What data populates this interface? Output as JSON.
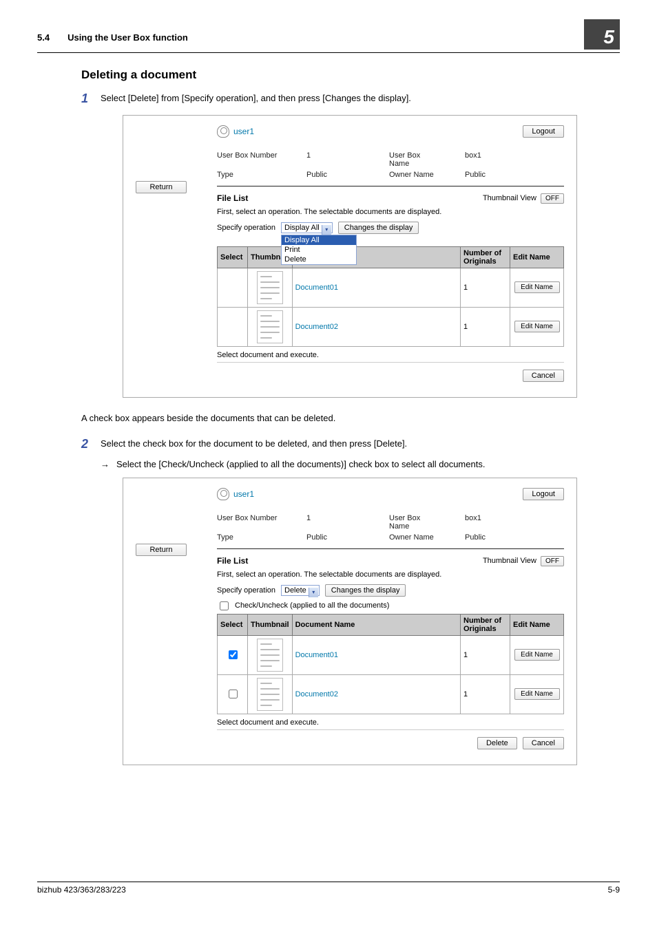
{
  "header": {
    "secnum": "5.4",
    "sectitle": "Using the User Box function",
    "chapnum": "5"
  },
  "subhead": "Deleting a document",
  "step1": {
    "num": "1",
    "text": "Select [Delete] from [Specify operation], and then press [Changes the display]."
  },
  "afterShot1": "A check box appears beside the documents that can be deleted.",
  "step2": {
    "num": "2",
    "text": "Select the check box for the document to be deleted, and then press [Delete].",
    "bullet": "Select the [Check/Uncheck (applied to all the documents)] check box to select all documents."
  },
  "app": {
    "username": "user1",
    "logout": "Logout",
    "return": "Return",
    "meta": {
      "boxnum_lbl": "User Box Number",
      "boxnum_val": "1",
      "boxname_lbl": "User Box\nName",
      "boxname_val": "box1",
      "type_lbl": "Type",
      "type_val": "Public",
      "owner_lbl": "Owner Name",
      "owner_val": "Public"
    },
    "filelist_lbl": "File List",
    "thumbview_lbl": "Thumbnail View",
    "off": "OFF",
    "first_hint": "First, select an operation. The selectable documents are displayed.",
    "specify_lbl": "Specify operation",
    "op_display": "Display All",
    "op_print": "Print",
    "op_delete": "Delete",
    "changes_btn": "Changes the display",
    "checkuncheck": "Check/Uncheck (applied to all the documents)",
    "cols": {
      "select": "Select",
      "thumb": "Thumbnail",
      "docname": "Document Name",
      "numorig": "Number of\nOriginals",
      "editname": "Edit Name"
    },
    "rows": [
      {
        "name": "Document01",
        "num": "1"
      },
      {
        "name": "Document02",
        "num": "1"
      }
    ],
    "editname_btn": "Edit Name",
    "select_execute": "Select document and execute.",
    "delete_btn": "Delete",
    "cancel_btn": "Cancel"
  },
  "footer": {
    "left": "bizhub 423/363/283/223",
    "right": "5-9"
  }
}
